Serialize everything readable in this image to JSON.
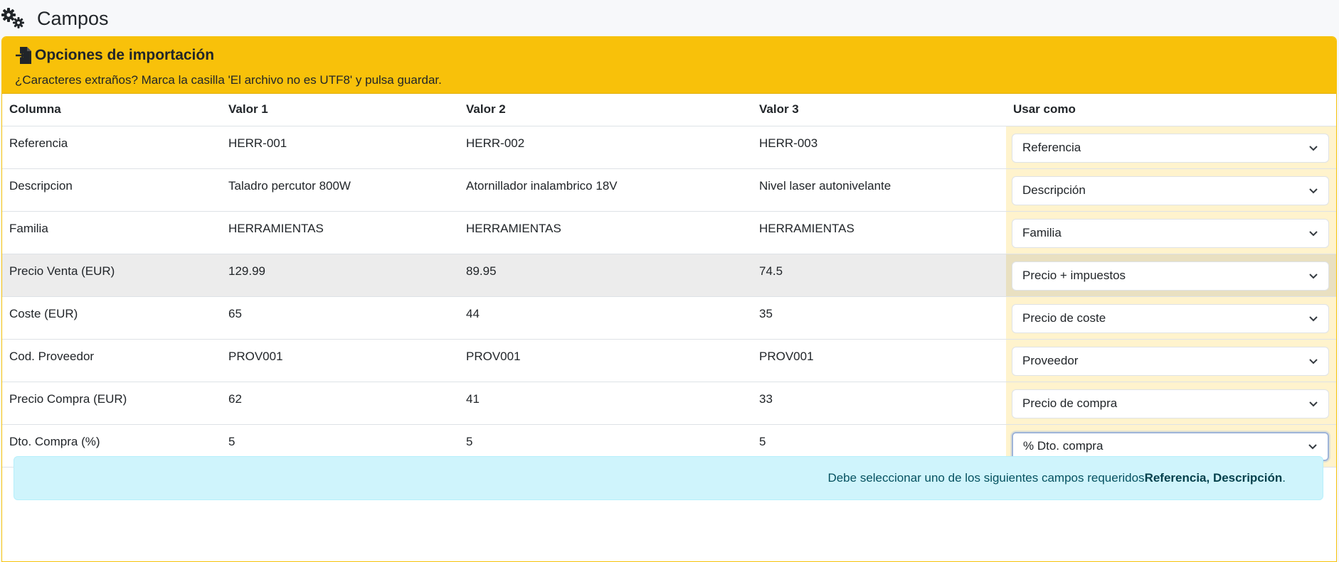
{
  "page": {
    "title": "Campos",
    "icon": "gears-icon"
  },
  "card": {
    "title": "Opciones de importación",
    "icon": "file-import-icon",
    "subtitle": "¿Caracteres extraños? Marca la casilla 'El archivo no es UTF8' y pulsa guardar.",
    "header_color": "#f8c10a"
  },
  "table": {
    "headers": [
      "Columna",
      "Valor 1",
      "Valor 2",
      "Valor 3",
      "Usar como"
    ],
    "rows": [
      {
        "col": "Referencia",
        "v1": "HERR-001",
        "v2": "HERR-002",
        "v3": "HERR-003",
        "use": "Referencia"
      },
      {
        "col": "Descripcion",
        "v1": "Taladro percutor 800W",
        "v2": "Atornillador inalambrico 18V",
        "v3": "Nivel laser autonivelante",
        "use": "Descripción"
      },
      {
        "col": "Familia",
        "v1": "HERRAMIENTAS",
        "v2": "HERRAMIENTAS",
        "v3": "HERRAMIENTAS",
        "use": "Familia"
      },
      {
        "col": "Precio Venta (EUR)",
        "v1": "129.99",
        "v2": "89.95",
        "v3": "74.5",
        "use": "Precio + impuestos"
      },
      {
        "col": "Coste (EUR)",
        "v1": "65",
        "v2": "44",
        "v3": "35",
        "use": "Precio de coste"
      },
      {
        "col": "Cod. Proveedor",
        "v1": "PROV001",
        "v2": "PROV001",
        "v3": "PROV001",
        "use": "Proveedor"
      },
      {
        "col": "Precio Compra (EUR)",
        "v1": "62",
        "v2": "41",
        "v3": "33",
        "use": "Precio de compra"
      },
      {
        "col": "Dto. Compra (%)",
        "v1": "5",
        "v2": "5",
        "v3": "5",
        "use": "% Dto. compra"
      }
    ]
  },
  "alert": {
    "text": "Debe seleccionar uno de los siguientes campos requeridos ",
    "required_fields": "Referencia, Descripción",
    "end": "."
  }
}
